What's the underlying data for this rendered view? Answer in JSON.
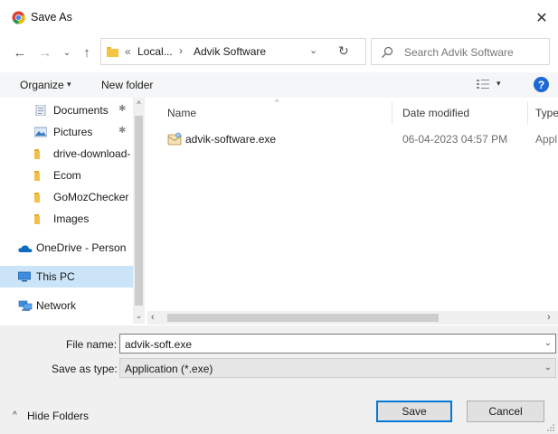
{
  "window": {
    "title": "Save As",
    "close_glyph": "✕",
    "icon": "chrome-icon"
  },
  "nav": {
    "back_glyph": "←",
    "forward_glyph": "→",
    "recent_glyph": "⌄",
    "up_glyph": "↑",
    "address": {
      "chevrons": "«",
      "segment1": "Local...",
      "separator": "›",
      "segment2": "Advik Software",
      "dropdown_glyph": "⌄",
      "refresh_glyph": "↻"
    },
    "search": {
      "placeholder": "Search Advik Software"
    }
  },
  "toolbar": {
    "organize_label": "Organize",
    "organize_caret": "▾",
    "new_folder_label": "New folder",
    "view_caret": "▾",
    "help_label": "?"
  },
  "sidebar": {
    "items": [
      {
        "label": "Documents",
        "icon": "documents-icon",
        "pinned": true
      },
      {
        "label": "Pictures",
        "icon": "pictures-icon",
        "pinned": true
      },
      {
        "label": "drive-download-",
        "icon": "folder-icon",
        "pinned": false
      },
      {
        "label": "Ecom",
        "icon": "folder-icon",
        "pinned": false
      },
      {
        "label": "GoMozChecker",
        "icon": "folder-icon",
        "pinned": false
      },
      {
        "label": "Images",
        "icon": "folder-icon",
        "pinned": false
      },
      {
        "label": "OneDrive - Person",
        "icon": "onedrive-icon",
        "pinned": false
      },
      {
        "label": "This PC",
        "icon": "this-pc-icon",
        "pinned": false,
        "selected": true
      },
      {
        "label": "Network",
        "icon": "network-icon",
        "pinned": false
      }
    ],
    "pin_glyph": "✱",
    "scroll_up_glyph": "^",
    "scroll_down_glyph": "⌄"
  },
  "file_list": {
    "sort_caret": "^",
    "columns": [
      "Name",
      "Date modified",
      "Type"
    ],
    "rows": [
      {
        "name": "advik-software.exe",
        "date_modified": "06-04-2023 04:57 PM",
        "type": "Appl"
      }
    ],
    "hscroll_left_glyph": "‹",
    "hscroll_right_glyph": "›"
  },
  "form": {
    "file_name_label": "File name:",
    "file_name_value": "advik-soft.exe",
    "save_as_type_label": "Save as type:",
    "save_as_type_value": "Application (*.exe)",
    "dropdown_glyph": "⌄"
  },
  "footer": {
    "hide_folders_caret": "^",
    "hide_folders_label": "Hide Folders",
    "save_label": "Save",
    "cancel_label": "Cancel"
  },
  "colors": {
    "selected_bg": "#cce4f7",
    "accent": "#0078d7",
    "help_blue": "#1d69d3",
    "bottom_bg": "#f0f0f0"
  }
}
